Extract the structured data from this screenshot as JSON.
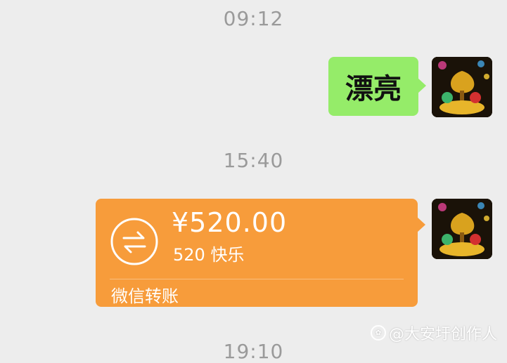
{
  "messages": {
    "time1": "09:12",
    "text_message": "漂亮",
    "time2": "15:40",
    "transfer": {
      "amount": "¥520.00",
      "note": "520 快乐",
      "footer": "微信转账"
    },
    "time3": "19:10"
  },
  "watermark": {
    "text": "@大安圩创作人"
  },
  "colors": {
    "background": "#ededed",
    "text_bubble": "#95ec69",
    "transfer_bubble": "#f79c3b",
    "timestamp": "#9a9a9a"
  },
  "icons": [
    "avatar",
    "transfer-arrows-icon",
    "paw-logo-icon"
  ]
}
